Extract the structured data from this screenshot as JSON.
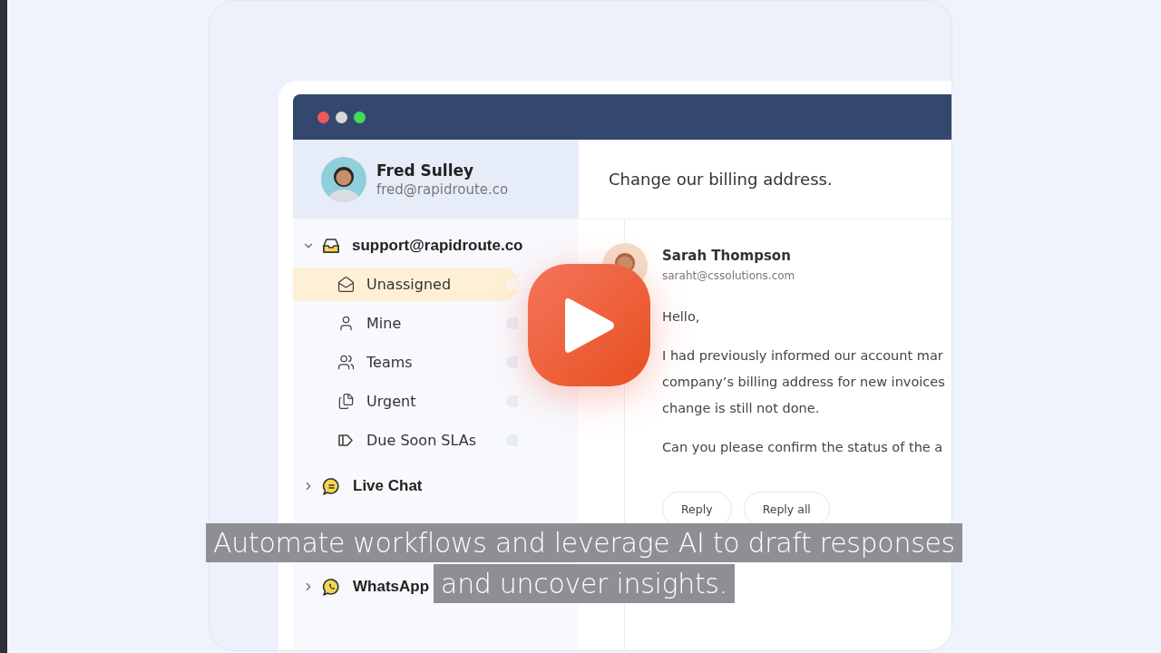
{
  "profile": {
    "name": "Fred Sulley",
    "email": "fred@rapidroute.co"
  },
  "inboxes": [
    {
      "label": "support@rapidroute.co",
      "kind": "email",
      "expanded": true,
      "children": [
        {
          "label": "Unassigned",
          "kind": "unassigned",
          "selected": true
        },
        {
          "label": "Mine",
          "kind": "mine",
          "selected": false
        },
        {
          "label": "Teams",
          "kind": "teams",
          "selected": false
        },
        {
          "label": "Urgent",
          "kind": "urgent",
          "selected": false
        },
        {
          "label": "Due Soon SLAs",
          "kind": "due",
          "selected": false
        }
      ]
    },
    {
      "label": "Live Chat",
      "kind": "chat",
      "expanded": false
    },
    {
      "label": "WhatsApp",
      "kind": "whatsapp",
      "expanded": false
    }
  ],
  "conversation": {
    "subject": "Change our billing address.",
    "sender": {
      "name": "Sarah Thompson",
      "email": "saraht@cssolutions.com"
    },
    "greeting": "Hello,",
    "paragraphs": [
      [
        "I had previously informed our account mar",
        "company’s billing address for new invoices",
        "change is still not done."
      ],
      [
        "Can you please confirm the status of the a"
      ]
    ],
    "actions": [
      "Reply",
      "Reply all"
    ]
  },
  "player": {
    "caption": [
      "Automate workflows and leverage AI to draft responses",
      "and uncover insights."
    ]
  }
}
